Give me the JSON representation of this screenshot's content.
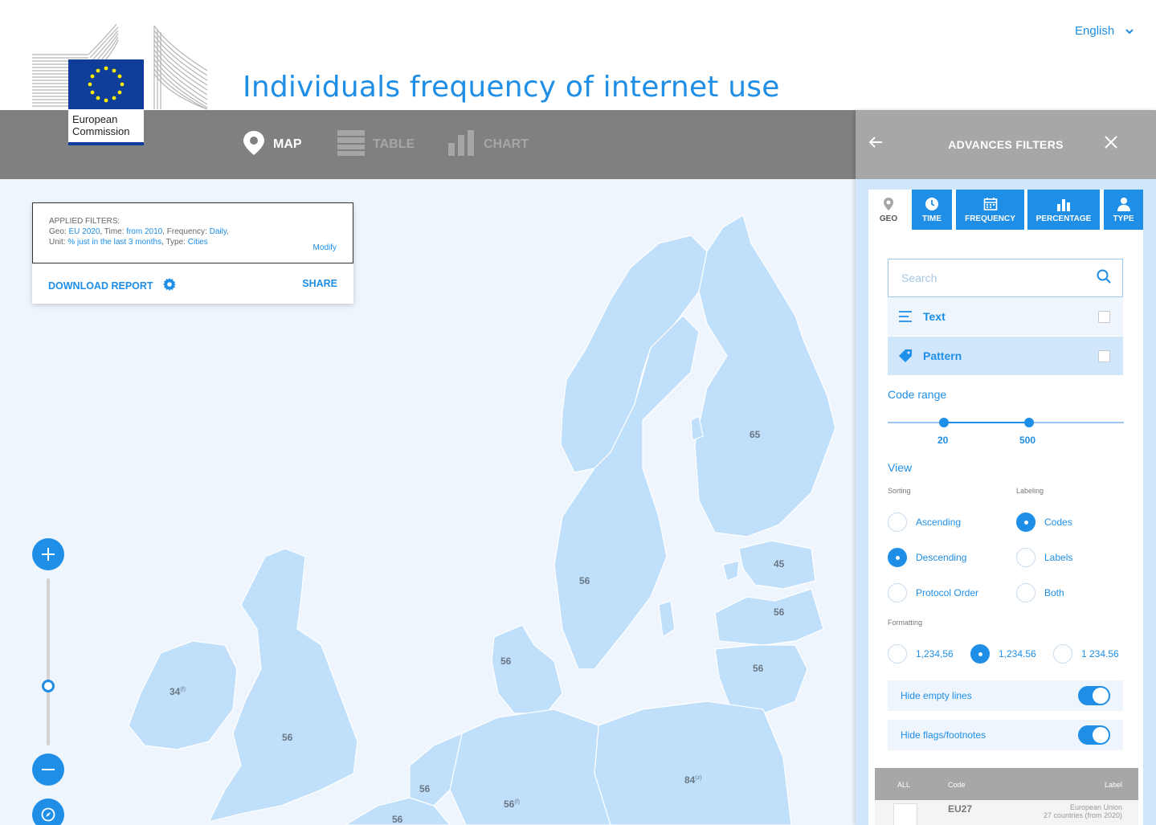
{
  "header": {
    "logo_text_line1": "European",
    "logo_text_line2": "Commission",
    "title": "Individuals frequency of internet use",
    "language": "English"
  },
  "nav": {
    "map": "MAP",
    "table": "TABLE",
    "chart": "CHART"
  },
  "applied_filters": {
    "heading": "APPLIED FILTERS:",
    "geo_label": "Geo:",
    "geo_value": "EU 2020",
    "time_label": "Time:",
    "time_value": "from 2010",
    "frequency_label": "Frequency:",
    "frequency_value": "Daily",
    "unit_label": "Unit:",
    "unit_value": "% just in the last 3 months",
    "type_label": "Type:",
    "type_value": "Cities",
    "modify": "Modify",
    "download": "DOWNLOAD REPORT",
    "share": "SHARE"
  },
  "map_labels": [
    {
      "id": "finland",
      "value": "65",
      "flag": ""
    },
    {
      "id": "sweden",
      "value": "56",
      "flag": ""
    },
    {
      "id": "estonia",
      "value": "45",
      "flag": ""
    },
    {
      "id": "latvia",
      "value": "56",
      "flag": ""
    },
    {
      "id": "lithuania",
      "value": "56",
      "flag": ""
    },
    {
      "id": "denmark",
      "value": "56",
      "flag": ""
    },
    {
      "id": "ireland",
      "value": "34",
      "flag": "(f)"
    },
    {
      "id": "uk",
      "value": "56",
      "flag": ""
    },
    {
      "id": "poland",
      "value": "84",
      "flag": "(z)"
    },
    {
      "id": "netherlands",
      "value": "56",
      "flag": ""
    },
    {
      "id": "germany",
      "value": "56",
      "flag": "(f)"
    },
    {
      "id": "belgium",
      "value": "56",
      "flag": ""
    }
  ],
  "panel": {
    "title": "ADVANCES FILTERS",
    "tabs": [
      {
        "label": "GEO",
        "icon": "pin-icon"
      },
      {
        "label": "TIME",
        "icon": "clock-icon"
      },
      {
        "label": "FREQUENCY",
        "icon": "calendar-icon"
      },
      {
        "label": "PERCENTAGE",
        "icon": "bar-chart-icon"
      },
      {
        "label": "TYPE",
        "icon": "person-icon"
      }
    ],
    "search_placeholder": "Search",
    "option_text": "Text",
    "option_pattern": "Pattern",
    "code_range_label": "Code range",
    "code_range_min": "20",
    "code_range_max": "500",
    "view_label": "View",
    "sorting_label": "Sorting",
    "labeling_label": "Labeling",
    "sorting_options": [
      "Ascending",
      "Descending",
      "Protocol Order"
    ],
    "sorting_selected": "Descending",
    "labeling_options": [
      "Codes",
      "Labels",
      "Both"
    ],
    "labeling_selected": "Codes",
    "formatting_label": "Formatting",
    "formatting_options": [
      "1,234,56",
      "1,234.56",
      "1 234.56"
    ],
    "formatting_selected": "1,234.56",
    "hide_empty_lines": "Hide empty lines",
    "hide_flags": "Hide flags/footnotes",
    "table_headers": {
      "all": "ALL",
      "code": "Code",
      "label": "Label"
    },
    "table_rows": [
      {
        "code": "EU27",
        "label_line1": "European Union",
        "label_line2": "27 countries (from 2020)"
      }
    ]
  },
  "colors": {
    "accent": "#1e8ee6",
    "navbar": "#808080",
    "panel_head": "#a7a7a7",
    "map_land": "#bfdffb",
    "map_sea": "#eef5fd"
  }
}
